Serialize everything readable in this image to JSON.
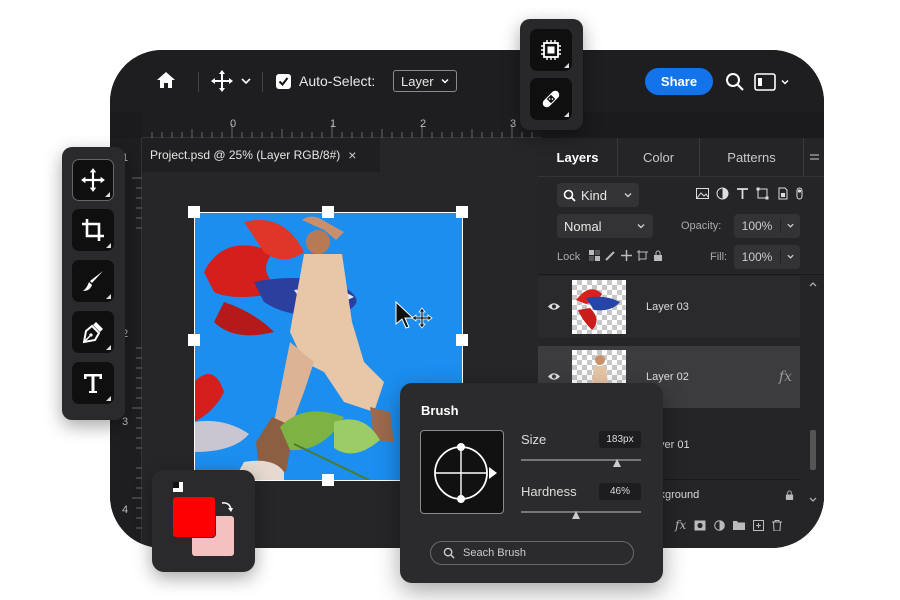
{
  "topbar": {
    "auto_select_label": "Auto-Select:",
    "layer_select_value": "Layer",
    "share_label": "Share"
  },
  "ruler": {
    "top_ticks": [
      "0",
      "1",
      "2",
      "3"
    ],
    "left_ticks": [
      "1",
      "2",
      "3",
      "4"
    ]
  },
  "document": {
    "tab_title": "Project.psd @ 25% (Layer RGB/8#)",
    "close_glyph": "×"
  },
  "layers_panel": {
    "tabs": [
      "Layers",
      "Color",
      "Patterns"
    ],
    "kind_label": "Kind",
    "blend_mode": "Nomal",
    "opacity_label": "Opacity:",
    "opacity_value": "100%",
    "lock_label": "Lock",
    "fill_label": "Fill:",
    "fill_value": "100%",
    "layers": [
      {
        "name": "Layer 03"
      },
      {
        "name": "Layer 02",
        "fx": "fx"
      },
      {
        "name": "yer 01"
      },
      {
        "name": "ckground"
      }
    ],
    "footer_fx": "fx"
  },
  "brush_panel": {
    "title": "Brush",
    "size_label": "Size",
    "size_value": "183px",
    "size_level": 0.8,
    "hardness_label": "Hardness",
    "hardness_value": "46%",
    "hardness_level": 0.46,
    "search_placeholder": "Seach Brush"
  },
  "colors": {
    "foreground": "#ff0000",
    "background": "#f4c0c0",
    "accent": "#1273eb",
    "canvas": "#1b8ef0"
  }
}
